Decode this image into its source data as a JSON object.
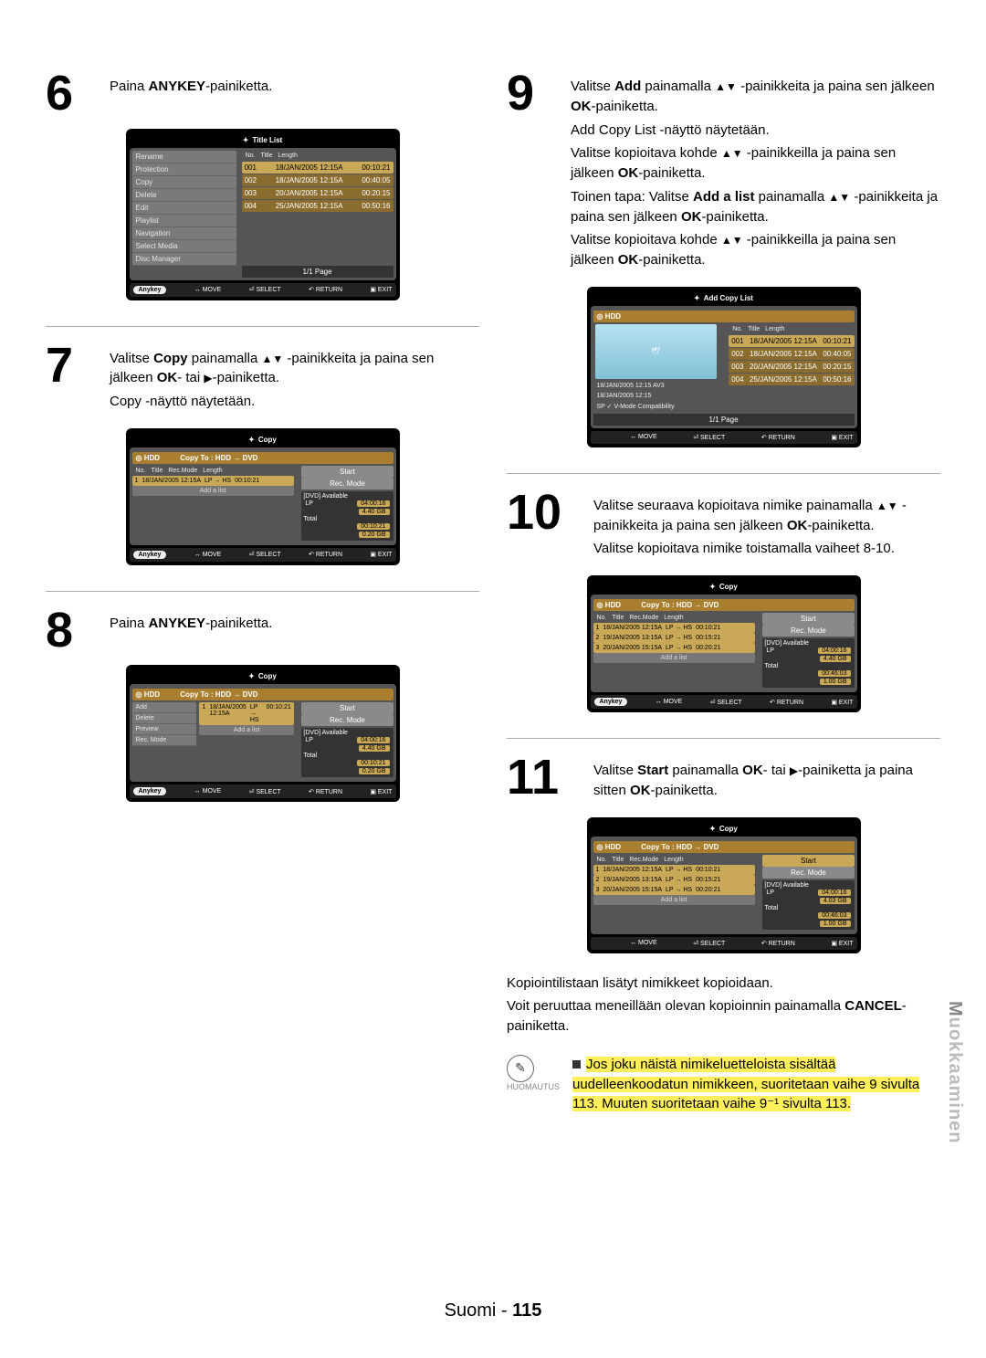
{
  "sidebar_label_hi": "M",
  "sidebar_label": "uokkaaminen",
  "footer_lang": "Suomi",
  "footer_sep": " - ",
  "footer_page": "115",
  "note_label": "HUOMAUTUS",
  "note_text": "Jos  joku näistä nimikeluetteloista sisältää uudelleenkoodatun nimikkeen, suoritetaan vaihe 9 sivulta 113. Muuten suoritetaan vaihe 9⁻¹ sivulta 113.",
  "after11_p1": "Kopiointilistaan lisätyt nimikkeet kopioidaan.",
  "after11_p2a": "Voit peruuttaa meneillään olevan kopioinnin painamalla ",
  "after11_p2b": "CANCEL",
  "after11_p2c": "-painiketta.",
  "steps": {
    "s6": {
      "num": "6",
      "text_a": "Paina ",
      "text_b": "ANYKEY",
      "text_c": "-painiketta."
    },
    "s7": {
      "num": "7",
      "a": "Valitse ",
      "b": "Copy",
      "c": " painamalla ",
      "d": " -painikkeita ja paina sen jälkeen ",
      "e": "OK",
      "f": "- tai ",
      "g": "-painiketta.",
      "p2": "Copy -näyttö näytetään."
    },
    "s8": {
      "num": "8",
      "text_a": "Paina ",
      "text_b": "ANYKEY",
      "text_c": "-painiketta."
    },
    "s9": {
      "num": "9",
      "a": "Valitse ",
      "b": "Add",
      "c": " painamalla ",
      "d": " -painikkeita ja paina sen jälkeen ",
      "e": "OK",
      "f": "-painiketta.",
      "p2": "Add Copy List -näyttö näytetään.",
      "p3a": "Valitse kopioitava kohde ",
      "p3b": " -painikkeilla ja paina sen jälkeen ",
      "p3c": "OK",
      "p3d": "-painiketta.",
      "p4a": "Toinen tapa: Valitse ",
      "p4b": "Add a list",
      "p4c": " painamalla ",
      "p4d": " -painikkeita ja paina sen jälkeen ",
      "p4e": "OK",
      "p4f": "-painiketta.",
      "p5a": "Valitse kopioitava kohde ",
      "p5b": " -painikkeilla ja paina sen jälkeen ",
      "p5c": "OK",
      "p5d": "-painiketta."
    },
    "s10": {
      "num": "10",
      "a": "Valitse seuraava kopioitava nimike painamalla ",
      "b": " -painikkeita ja paina sen jälkeen ",
      "c": "OK",
      "d": "-painiketta.",
      "p2": "Valitse kopioitava nimike toistamalla vaiheet 8-10."
    },
    "s11": {
      "num": "11",
      "a": "Valitse ",
      "b": "Start",
      "c": " painamalla ",
      "d": "OK",
      "e": "- tai ",
      "f": "-painiketta ja paina sitten ",
      "g": "OK",
      "h": "-painiketta."
    }
  },
  "osd_common": {
    "anykey": "Anykey",
    "move": "MOVE",
    "select": "SELECT",
    "return": "RETURN",
    "exit": "EXIT",
    "page": "1/1 Page",
    "hdd": "HDD"
  },
  "osd6": {
    "title": "Title List",
    "menu": [
      "Rename",
      "Protection",
      "Copy",
      "Delete",
      "Edit",
      "Playlist",
      "Navigation",
      "Select Media",
      "Disc Manager"
    ],
    "head": [
      "No.",
      "Title",
      "Length"
    ],
    "rows": [
      {
        "no": "001",
        "t": "18/JAN/2005 12:15A",
        "len": "00:10:21",
        "hi": true
      },
      {
        "no": "002",
        "t": "18/JAN/2005 12:15A",
        "len": "00:40:05"
      },
      {
        "no": "003",
        "t": "20/JAN/2005 12:15A",
        "len": "00:20:15"
      },
      {
        "no": "004",
        "t": "25/JAN/2005 12:15A",
        "len": "00:50:16"
      }
    ]
  },
  "osd_copy": {
    "title": "Copy",
    "subtitle": "Copy To : HDD → DVD",
    "thead": [
      "No.",
      "Title",
      "Rec.Mode",
      "Length"
    ],
    "add_a_list": "Add a list",
    "side_start": "Start",
    "side_recmode": "Rec. Mode",
    "side_dvd": "[DVD] Available",
    "side_lp": "LP",
    "side_total": "Total"
  },
  "osd7": {
    "rows": [
      {
        "no": "1",
        "t": "18/JAN/2005 12:15A",
        "rm": "LP → HS",
        "len": "00:10:21"
      }
    ],
    "vals": {
      "lp_time": "04:00:16",
      "lp_gb": "4.40 GB",
      "tot_time": "00:10:21",
      "tot_gb": "0.20 GB"
    }
  },
  "osd8": {
    "menu2": [
      "Add",
      "Delete",
      "Preview",
      "Rec. Mode"
    ],
    "rows": [
      {
        "no": "1",
        "t": "18/JAN/2005 12:15A",
        "rm": "LP → HS",
        "len": "00:10:21"
      }
    ],
    "vals": {
      "lp_time": "04:00:16",
      "lp_gb": "4.40 GB",
      "tot_time": "00:10:21",
      "tot_gb": "0.20 GB"
    }
  },
  "osd9": {
    "title": "Add Copy List",
    "rows": [
      {
        "no": "001",
        "t": "18/JAN/2005 12:15A",
        "len": "00:10:21",
        "hi": true
      },
      {
        "no": "002",
        "t": "18/JAN/2005 12:15A",
        "len": "00:40:05"
      },
      {
        "no": "003",
        "t": "20/JAN/2005 12:15A",
        "len": "00:20:15"
      },
      {
        "no": "004",
        "t": "25/JAN/2005 12:15A",
        "len": "00:50:16"
      }
    ],
    "info1": "18/JAN/2005 12:15 AV3",
    "info2": "18/JAN/2005 12:15",
    "info3": "SP ✓ V-Mode Compatibility"
  },
  "osd10": {
    "rows": [
      {
        "no": "1",
        "t": "18/JAN/2005 12:15A",
        "rm": "LP → HS",
        "len": "00:10:21"
      },
      {
        "no": "2",
        "t": "19/JAN/2005 13:15A",
        "rm": "LP → HS",
        "len": "00:15:21"
      },
      {
        "no": "3",
        "t": "20/JAN/2005 15:15A",
        "rm": "LP → HS",
        "len": "00:20:21"
      }
    ],
    "vals": {
      "lp_time": "04:00:16",
      "lp_gb": "4.40 GB",
      "tot_time": "00:46:03",
      "tot_gb": "1.00 GB"
    }
  },
  "osd11": {
    "rows": [
      {
        "no": "1",
        "t": "18/JAN/2005 12:15A",
        "rm": "LP → HS",
        "len": "00:10:21"
      },
      {
        "no": "2",
        "t": "19/JAN/2005 13:15A",
        "rm": "LP → HS",
        "len": "00:15:21"
      },
      {
        "no": "3",
        "t": "20/JAN/2005 15:15A",
        "rm": "LP → HS",
        "len": "00:20:21"
      }
    ],
    "vals": {
      "lp_time": "04:00:16",
      "lp_gb": "4.03 GB",
      "tot_time": "00:46:03",
      "tot_gb": "1.00 GB"
    }
  }
}
